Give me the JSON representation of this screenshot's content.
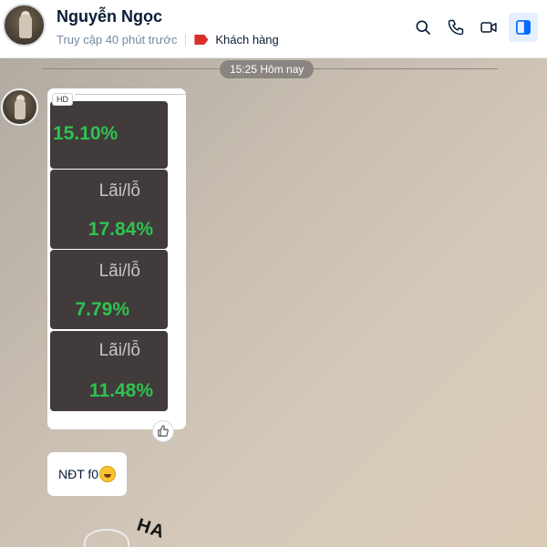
{
  "header": {
    "name": "Nguyễn Ngọc",
    "last_seen": "Truy cập 40 phút trước",
    "tag_label": "Khách hàng",
    "tag_color": "#d9302b",
    "icons": [
      "search-icon",
      "phone-icon",
      "video-icon",
      "sidebar-toggle-icon"
    ]
  },
  "chat": {
    "date_separator": "15:25 Hôm nay",
    "image_message": {
      "badge": "HD",
      "cards": [
        {
          "label": "",
          "value": "15.10%"
        },
        {
          "label": "Lãi/lỗ",
          "value": "17.84%"
        },
        {
          "label": "Lãi/lỗ",
          "value": "7.79%"
        },
        {
          "label": "Lãi/lỗ",
          "value": "11.48%"
        }
      ]
    },
    "text_message": "NĐT f0",
    "sticker_text": "HA"
  },
  "colors": {
    "profit_green": "#2fc251",
    "card_bg": "#413b3b",
    "accent_blue": "#0068ff"
  }
}
